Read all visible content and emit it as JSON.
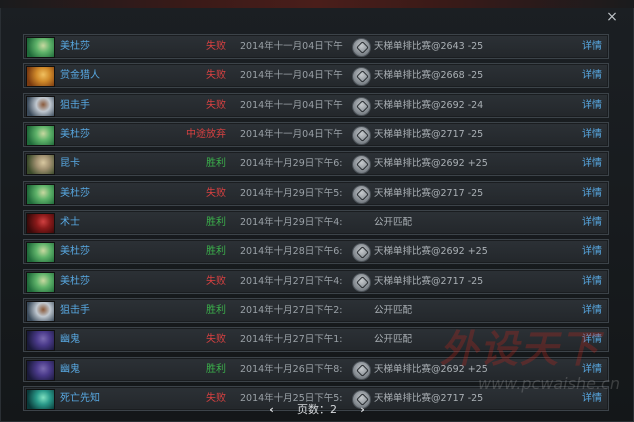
{
  "window": {
    "close_symbol": "×"
  },
  "colors": {
    "win": "#3bb04b",
    "lose": "#d94141",
    "abandon": "#d94141",
    "link": "#58a9e3"
  },
  "rows": [
    {
      "hero": "美杜莎",
      "result": "失败",
      "rtype": "lose",
      "date": "2014年十一月04日下午",
      "mode_icon": true,
      "mode": "天梯单排比赛@2643 -25",
      "detail": "详情",
      "avatar": "medusa"
    },
    {
      "hero": "赏金猎人",
      "result": "失败",
      "rtype": "lose",
      "date": "2014年十一月04日下午",
      "mode_icon": true,
      "mode": "天梯单排比赛@2668 -25",
      "detail": "详情",
      "avatar": "bounty"
    },
    {
      "hero": "狙击手",
      "result": "失败",
      "rtype": "lose",
      "date": "2014年十一月04日下午",
      "mode_icon": true,
      "mode": "天梯单排比赛@2692 -24",
      "detail": "详情",
      "avatar": "sniper"
    },
    {
      "hero": "美杜莎",
      "result": "中途放弃",
      "rtype": "abandon",
      "date": "2014年十一月04日下午",
      "mode_icon": true,
      "mode": "天梯单排比赛@2717 -25",
      "detail": "详情",
      "avatar": "medusa"
    },
    {
      "hero": "昆卡",
      "result": "胜利",
      "rtype": "win",
      "date": "2014年十月29日下午6:",
      "mode_icon": true,
      "mode": "天梯单排比赛@2692 +25",
      "detail": "详情",
      "avatar": "kunkka"
    },
    {
      "hero": "美杜莎",
      "result": "失败",
      "rtype": "lose",
      "date": "2014年十月29日下午5:",
      "mode_icon": true,
      "mode": "天梯单排比赛@2717 -25",
      "detail": "详情",
      "avatar": "medusa"
    },
    {
      "hero": "术士",
      "result": "胜利",
      "rtype": "win",
      "date": "2014年十月29日下午4:",
      "mode_icon": false,
      "mode": "公开匹配",
      "detail": "详情",
      "avatar": "warlock"
    },
    {
      "hero": "美杜莎",
      "result": "胜利",
      "rtype": "win",
      "date": "2014年十月28日下午6:",
      "mode_icon": true,
      "mode": "天梯单排比赛@2692 +25",
      "detail": "详情",
      "avatar": "medusa"
    },
    {
      "hero": "美杜莎",
      "result": "失败",
      "rtype": "lose",
      "date": "2014年十月27日下午4:",
      "mode_icon": true,
      "mode": "天梯单排比赛@2717 -25",
      "detail": "详情",
      "avatar": "medusa"
    },
    {
      "hero": "狙击手",
      "result": "胜利",
      "rtype": "win",
      "date": "2014年十月27日下午2:",
      "mode_icon": false,
      "mode": "公开匹配",
      "detail": "详情",
      "avatar": "sniper"
    },
    {
      "hero": "幽鬼",
      "result": "失败",
      "rtype": "lose",
      "date": "2014年十月27日下午1:",
      "mode_icon": false,
      "mode": "公开匹配",
      "detail": "详情",
      "avatar": "spectre"
    },
    {
      "hero": "幽鬼",
      "result": "胜利",
      "rtype": "win",
      "date": "2014年十月26日下午8:",
      "mode_icon": true,
      "mode": "天梯单排比赛@2692 +25",
      "detail": "详情",
      "avatar": "spectre"
    },
    {
      "hero": "死亡先知",
      "result": "失败",
      "rtype": "lose",
      "date": "2014年十月25日下午5:",
      "mode_icon": true,
      "mode": "天梯单排比赛@2717 -25",
      "detail": "详情",
      "avatar": "deathprophet"
    }
  ],
  "avatar_colors": {
    "medusa": [
      "#1f6a3a",
      "#5fb36a",
      "#c8d8a0"
    ],
    "bounty": [
      "#7a3a10",
      "#d08a2a",
      "#f0c060"
    ],
    "sniper": [
      "#3a4a5a",
      "#c0c8d0",
      "#8a5a3a"
    ],
    "kunkka": [
      "#3a4a2a",
      "#a09070",
      "#d8c8a0"
    ],
    "warlock": [
      "#3a0a0a",
      "#8a1a1a",
      "#d04040"
    ],
    "spectre": [
      "#1a1a3a",
      "#4a3a8a",
      "#7a6ab0"
    ],
    "deathprophet": [
      "#0a3a3a",
      "#2a9a8a",
      "#80e0c0"
    ]
  },
  "pager": {
    "prev_symbol": "‹",
    "label": "页数：",
    "page": "2",
    "next_symbol": "›"
  },
  "watermark": {
    "main": "外设天下",
    "sub": "www.pcwaishe.cn"
  }
}
